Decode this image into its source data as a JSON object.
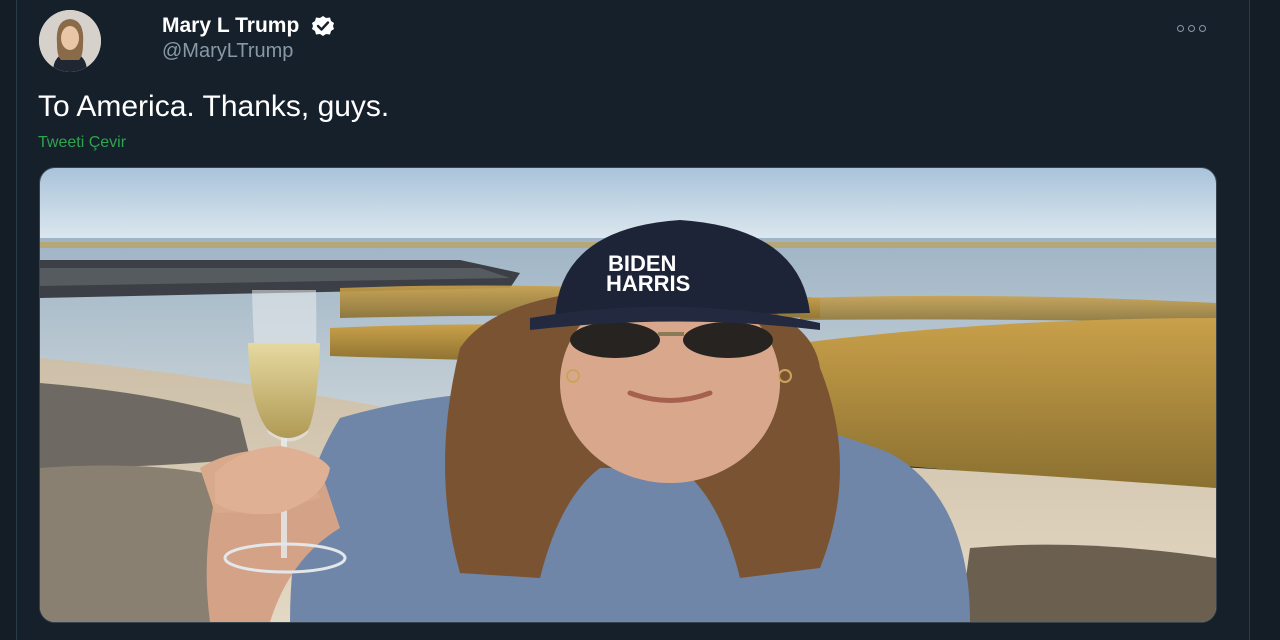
{
  "author": {
    "name": "Mary L Trump",
    "handle": "@MaryLTrump",
    "verified_icon": "verified-badge-icon"
  },
  "tweet": {
    "text": "To America. Thanks, guys.",
    "translate_label": "Tweeti Çevir"
  },
  "media": {
    "cap_text_line1": "BIDEN",
    "cap_text_line2": "HARRIS"
  },
  "colors": {
    "background": "#15202b",
    "translate_link": "#2ea44f",
    "secondary_text": "#8899a6"
  }
}
